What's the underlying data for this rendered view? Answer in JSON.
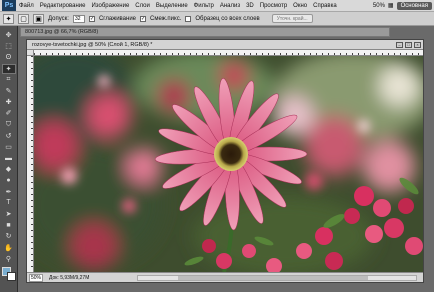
{
  "app": {
    "logo": "Ps"
  },
  "menu": {
    "items": [
      "Файл",
      "Редактирование",
      "Изображение",
      "Слои",
      "Выделение",
      "Фильтр",
      "Анализ",
      "3D",
      "Просмотр",
      "Окно",
      "Справка"
    ],
    "zoom": "50%",
    "essentials": "Основная"
  },
  "options": {
    "feather_label": "Допуск:",
    "feather_value": "32",
    "antialias_label": "Сглаживание",
    "contiguous_label": "Смеж.пикс.",
    "sample_all_label": "Образец со всех слоев",
    "refine_button": "Уточн. край..."
  },
  "tools": [
    "move",
    "marquee",
    "lasso",
    "wand",
    "crop",
    "eyedropper",
    "healing",
    "brush",
    "stamp",
    "history",
    "eraser",
    "gradient",
    "blur",
    "dodge",
    "pen",
    "type",
    "path",
    "shape",
    "3d",
    "hand",
    "zoom"
  ],
  "documents": {
    "back_tab": "800713.jpg @ 66,7% (RGB/8)",
    "active_title": "rozovye-tsvetochki.jpg @ 50% (Слой 1, RGB/8) *"
  },
  "status": {
    "zoom": "50%",
    "doc_info": "Док: 5,93M/9,27M"
  },
  "colors": {
    "accent": "#3a6ea5",
    "foreground": "#7aaed0",
    "background": "#ffffff"
  }
}
